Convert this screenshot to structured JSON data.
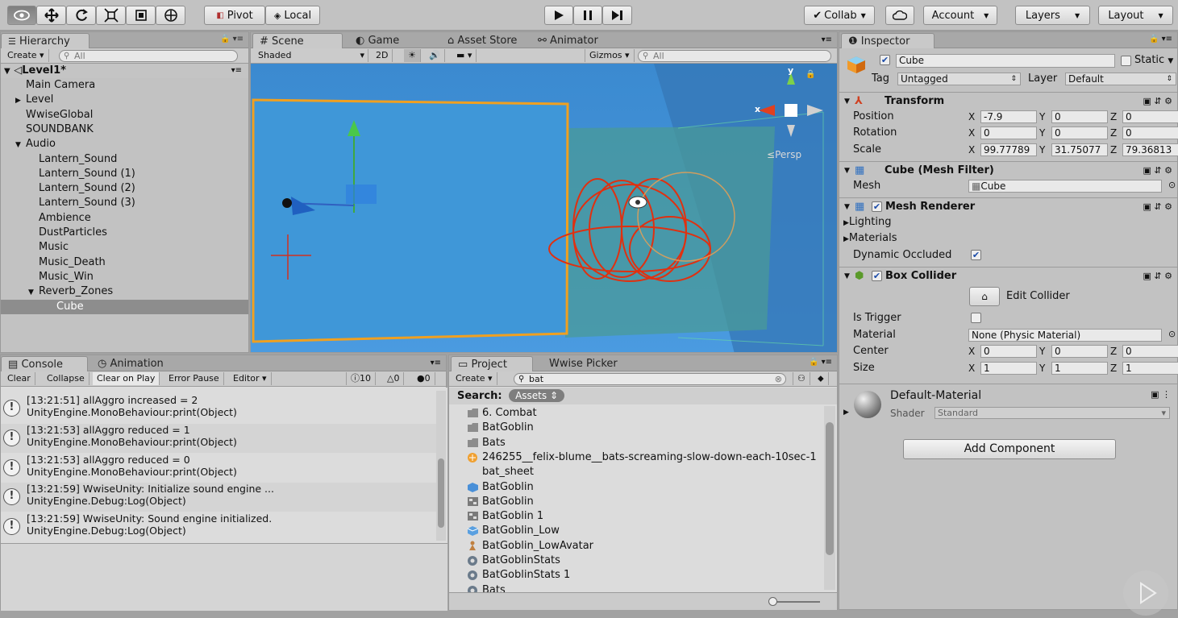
{
  "toolbar": {
    "tools": [
      "view-tool",
      "move-tool",
      "rotate-tool",
      "scale-tool",
      "rect-tool",
      "transform-tool"
    ],
    "pivot": "Pivot",
    "local": "Local",
    "collab": "Collab",
    "account": "Account",
    "layers": "Layers",
    "layout": "Layout"
  },
  "hierarchy": {
    "tab": "Hierarchy",
    "create": "Create",
    "search_placeholder": "All",
    "scene": "Level1*",
    "items": [
      {
        "label": "Main Camera",
        "indent": 0,
        "arrow": ""
      },
      {
        "label": "Level",
        "indent": 0,
        "arrow": "▶"
      },
      {
        "label": "WwiseGlobal",
        "indent": 0,
        "arrow": ""
      },
      {
        "label": "SOUNDBANK",
        "indent": 0,
        "arrow": ""
      },
      {
        "label": "Audio",
        "indent": 0,
        "arrow": "▼"
      },
      {
        "label": "Lantern_Sound",
        "indent": 1,
        "arrow": ""
      },
      {
        "label": "Lantern_Sound (1)",
        "indent": 1,
        "arrow": ""
      },
      {
        "label": "Lantern_Sound (2)",
        "indent": 1,
        "arrow": ""
      },
      {
        "label": "Lantern_Sound (3)",
        "indent": 1,
        "arrow": ""
      },
      {
        "label": "Ambience",
        "indent": 1,
        "arrow": ""
      },
      {
        "label": "DustParticles",
        "indent": 1,
        "arrow": ""
      },
      {
        "label": "Music",
        "indent": 1,
        "arrow": ""
      },
      {
        "label": "Music_Death",
        "indent": 1,
        "arrow": ""
      },
      {
        "label": "Music_Win",
        "indent": 1,
        "arrow": ""
      },
      {
        "label": "Reverb_Zones",
        "indent": 1,
        "arrow": "▼"
      },
      {
        "label": "Cube",
        "indent": 2,
        "arrow": "",
        "selected": true
      }
    ]
  },
  "scene": {
    "tabs": [
      "Scene",
      "Game",
      "Asset Store",
      "Animator"
    ],
    "shading": "Shaded",
    "mode_2d": "2D",
    "gizmos": "Gizmos",
    "search_placeholder": "All",
    "persp": "Persp",
    "axis_x": "x",
    "axis_y": "y"
  },
  "inspector": {
    "tab": "Inspector",
    "object_name": "Cube",
    "static": "Static",
    "tag_label": "Tag",
    "tag": "Untagged",
    "layer_label": "Layer",
    "layer": "Default",
    "transform": {
      "title": "Transform",
      "position_label": "Position",
      "position": [
        "-7.9",
        "0",
        "0"
      ],
      "rotation_label": "Rotation",
      "rotation": [
        "0",
        "0",
        "0"
      ],
      "scale_label": "Scale",
      "scale": [
        "99.77789",
        "31.75077",
        "79.36813"
      ]
    },
    "mesh_filter": {
      "title": "Cube (Mesh Filter)",
      "mesh_label": "Mesh",
      "mesh": "Cube"
    },
    "mesh_renderer": {
      "title": "Mesh Renderer",
      "lighting": "Lighting",
      "materials": "Materials",
      "dynamic_occluded": "Dynamic Occluded"
    },
    "box_collider": {
      "title": "Box Collider",
      "edit_collider": "Edit Collider",
      "is_trigger": "Is Trigger",
      "material_label": "Material",
      "material": "None (Physic Material)",
      "center_label": "Center",
      "center": [
        "0",
        "0",
        "0"
      ],
      "size_label": "Size",
      "size": [
        "1",
        "1",
        "1"
      ]
    },
    "material": {
      "name": "Default-Material",
      "shader_label": "Shader",
      "shader": "Standard"
    },
    "add_component": "Add Component",
    "axes": [
      "X",
      "Y",
      "Z"
    ]
  },
  "console": {
    "tabs": [
      "Console",
      "Animation"
    ],
    "buttons": [
      "Clear",
      "Collapse",
      "Clear on Play",
      "Error Pause",
      "Editor"
    ],
    "counts": {
      "info": "10",
      "warn": "0",
      "error": "0"
    },
    "entries": [
      {
        "line1": "[13:21:51] allAggro increased = 2",
        "line2": "UnityEngine.MonoBehaviour:print(Object)"
      },
      {
        "line1": "[13:21:53] allAggro reduced = 1",
        "line2": "UnityEngine.MonoBehaviour:print(Object)"
      },
      {
        "line1": "[13:21:53] allAggro reduced = 0",
        "line2": "UnityEngine.MonoBehaviour:print(Object)"
      },
      {
        "line1": "[13:21:59] WwiseUnity: Initialize sound engine ...",
        "line2": "UnityEngine.Debug:Log(Object)"
      },
      {
        "line1": "[13:21:59] WwiseUnity: Sound engine initialized.",
        "line2": "UnityEngine.Debug:Log(Object)"
      }
    ]
  },
  "project": {
    "tabs": [
      "Project",
      "Wwise Picker"
    ],
    "create": "Create",
    "search_value": "bat",
    "search_label": "Search:",
    "assets_chip": "Assets",
    "items": [
      {
        "label": "6. Combat",
        "icon": "folder"
      },
      {
        "label": "BatGoblin",
        "icon": "folder"
      },
      {
        "label": "Bats",
        "icon": "folder"
      },
      {
        "label": "246255__felix-blume__bats-screaming-slow-down-each-10sec-1",
        "icon": "audio"
      },
      {
        "label": "bat_sheet",
        "icon": "none"
      },
      {
        "label": "BatGoblin",
        "icon": "prefab"
      },
      {
        "label": "BatGoblin",
        "icon": "controller"
      },
      {
        "label": "BatGoblin 1",
        "icon": "controller"
      },
      {
        "label": "BatGoblin_Low",
        "icon": "model"
      },
      {
        "label": "BatGoblin_LowAvatar",
        "icon": "avatar"
      },
      {
        "label": "BatGoblinStats",
        "icon": "asset"
      },
      {
        "label": "BatGoblinStats 1",
        "icon": "asset"
      },
      {
        "label": "Bats",
        "icon": "asset"
      }
    ]
  },
  "colors": {
    "sky": "#3d8fd0",
    "selection_orange": "#f0a020",
    "gizmo_red": "#e03010"
  }
}
